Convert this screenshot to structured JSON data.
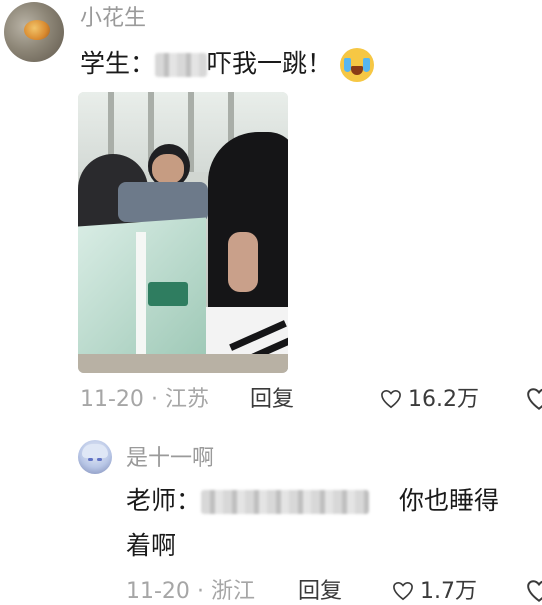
{
  "comment": {
    "username": "小花生",
    "text_prefix": "学生：",
    "text_suffix": "吓我一跳！",
    "emoji": "crying-laughing-emoji",
    "date": "11-20",
    "separator": "·",
    "location": "江苏",
    "reply_label": "回复",
    "likes": "16.2万"
  },
  "reply": {
    "username": "是十一啊",
    "text_prefix": "老师：",
    "text_line1_end": "你也睡得",
    "text_line2": "着啊",
    "date": "11-20",
    "separator": "·",
    "location": "浙江",
    "reply_label": "回复",
    "likes": "1.7万"
  },
  "colors": {
    "meta_gray": "#a6a6a6",
    "text": "#1a1a1a"
  }
}
